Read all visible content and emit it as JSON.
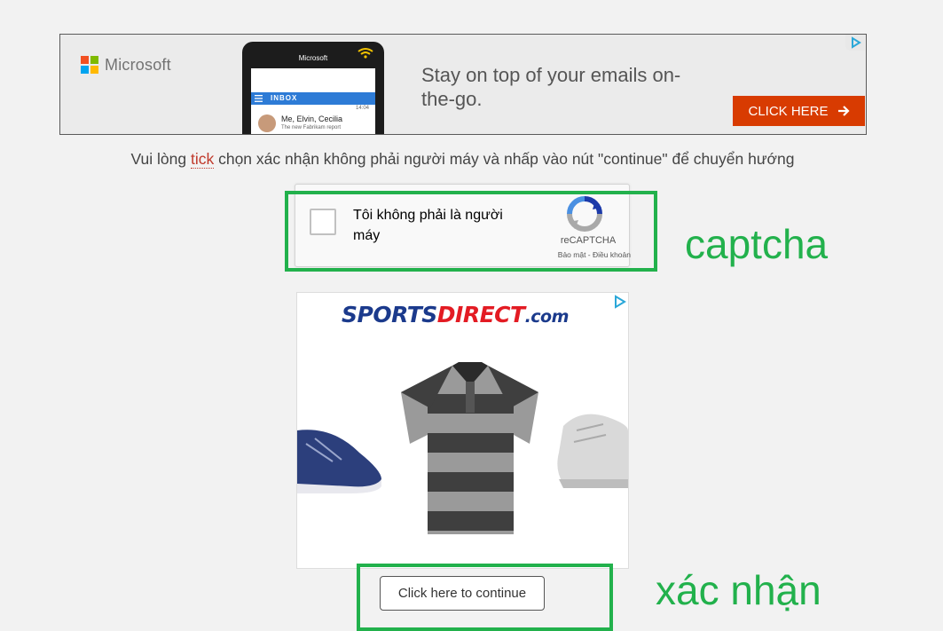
{
  "top_ad": {
    "brand": "Microsoft",
    "phone_brand": "Microsoft",
    "inbox_label": "INBOX",
    "email_from": "Me, Elvin, Cecilia",
    "email_subject": "The new Fabrikam report",
    "email_time": "14:04",
    "headline": "Stay on top of your emails on-the-go.",
    "cta_label": "CLICK HERE",
    "colors": {
      "cta": "#d83b01",
      "ms_red": "#f25022",
      "ms_green": "#7fba00",
      "ms_blue": "#00a4ef",
      "ms_yellow": "#ffb900"
    }
  },
  "instruction": {
    "before": "Vui lòng ",
    "link": "tick",
    "after": " chọn xác nhận không phải người máy và nhấp vào nút \"continue\" để chuyển hướng"
  },
  "captcha": {
    "label": "Tôi không phải là người máy",
    "brand": "reCAPTCHA",
    "links": "Bảo mật - Điều khoản",
    "annotation": "captcha",
    "annotation_color": "#22b14c"
  },
  "side_ad": {
    "logo_sports": "SPORTS",
    "logo_direct": "DIRECT",
    "logo_com": ".com"
  },
  "continue": {
    "label": "Click here to continue",
    "annotation": "xác nhận"
  }
}
